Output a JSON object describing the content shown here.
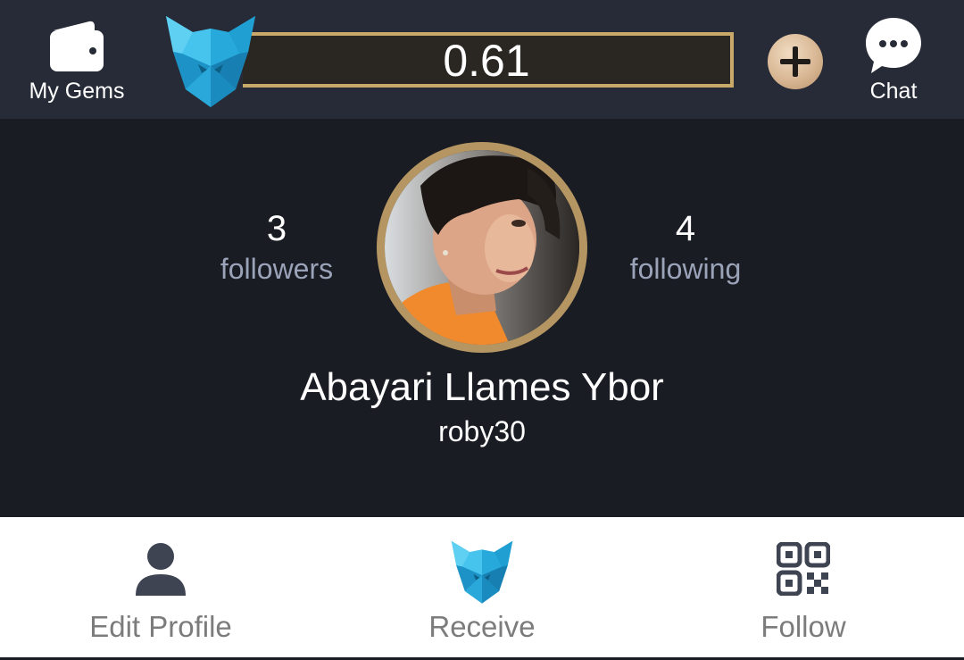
{
  "topbar": {
    "gems_label": "My Gems",
    "balance": "0.61",
    "chat_label": "Chat"
  },
  "profile": {
    "followers_count": "3",
    "followers_label": "followers",
    "following_count": "4",
    "following_label": "following",
    "name": "Abayari Llames Ybor",
    "username": "roby30"
  },
  "bottom_tabs": [
    {
      "label": "Edit Profile",
      "icon": "person-icon"
    },
    {
      "label": "Receive",
      "icon": "fox-logo-icon"
    },
    {
      "label": "Follow",
      "icon": "qr-code-icon"
    }
  ],
  "colors": {
    "topbar_bg": "#262b37",
    "page_bg": "#1a1c24",
    "gold_accent": "#c9a96a",
    "muted_text": "#9aa3b8",
    "tab_text": "#7c7c7c",
    "logo_blue": "#2fb6e6"
  }
}
